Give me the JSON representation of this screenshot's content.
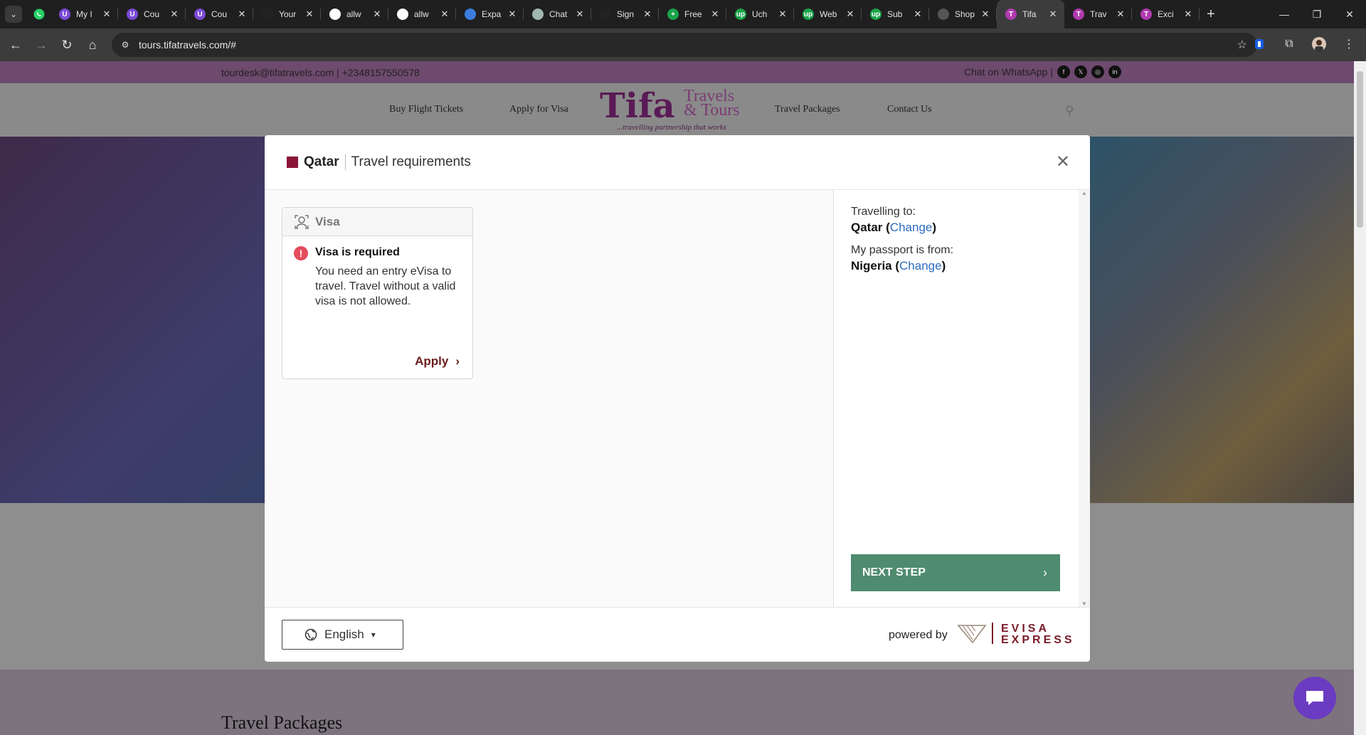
{
  "browser": {
    "tabs": [
      {
        "title": "My I",
        "color": "#7b4ad6",
        "glyph": "U"
      },
      {
        "title": "Cou",
        "color": "#7b4ad6",
        "glyph": "U"
      },
      {
        "title": "Cou",
        "color": "#7b4ad6",
        "glyph": "U"
      },
      {
        "title": "Your",
        "color": "#222222",
        "glyph": ""
      },
      {
        "title": "allw",
        "color": "#ffffff",
        "glyph": ""
      },
      {
        "title": "allw",
        "color": "#ffffff",
        "glyph": ""
      },
      {
        "title": "Expa",
        "color": "#3b7ddd",
        "glyph": ""
      },
      {
        "title": "Chat",
        "color": "#9fb8b0",
        "glyph": ""
      },
      {
        "title": "Sign",
        "color": "#222222",
        "glyph": ""
      },
      {
        "title": "Free",
        "color": "#1aa34a",
        "glyph": "+"
      },
      {
        "title": "Uch",
        "color": "#1aa34a",
        "glyph": "up"
      },
      {
        "title": "Web",
        "color": "#1aa34a",
        "glyph": "up"
      },
      {
        "title": "Sub",
        "color": "#1aa34a",
        "glyph": "up"
      },
      {
        "title": "Shop",
        "color": "#555555",
        "glyph": ""
      },
      {
        "title": "Tifa",
        "color": "#b03ab0",
        "glyph": "T",
        "active": true
      },
      {
        "title": "Trav",
        "color": "#b03ab0",
        "glyph": "T"
      },
      {
        "title": "Exci",
        "color": "#b03ab0",
        "glyph": "T"
      }
    ],
    "url": "tours.tifatravels.com/#"
  },
  "site": {
    "contact": "tourdesk@tifatravels.com | +2348157550578",
    "chat_whatsapp": "Chat on WhatsApp |",
    "menu": {
      "flights": "Buy Flight Tickets",
      "visa": "Apply for Visa",
      "packages": "Travel Packages",
      "contact": "Contact Us"
    },
    "logo": {
      "main": "Tifa",
      "sub1": "Travels",
      "sub2": "& Tours",
      "tagline": "...travelling partnership that works"
    },
    "section_title": "Travel Packages"
  },
  "modal": {
    "country": "Qatar",
    "title": "Travel requirements",
    "visa_card": {
      "heading": "Visa",
      "status": "Visa is required",
      "description": "You need an entry eVisa to travel. Travel without a valid visa is not allowed.",
      "apply": "Apply"
    },
    "travelling_to_label": "Travelling to:",
    "travelling_to": "Qatar",
    "passport_label": "My passport is from:",
    "passport": "Nigeria",
    "change": "Change",
    "next_step": "NEXT STEP",
    "language": "English",
    "powered_by": "powered by",
    "brand_line1": "EVISA",
    "brand_line2": "EXPRESS"
  },
  "colors": {
    "accent_green": "#4e8b6f",
    "link_blue": "#2d6cc0",
    "alert_red": "#e44c5a",
    "apply_maroon": "#6b1d1d",
    "brand_purple": "#5a1a55"
  }
}
